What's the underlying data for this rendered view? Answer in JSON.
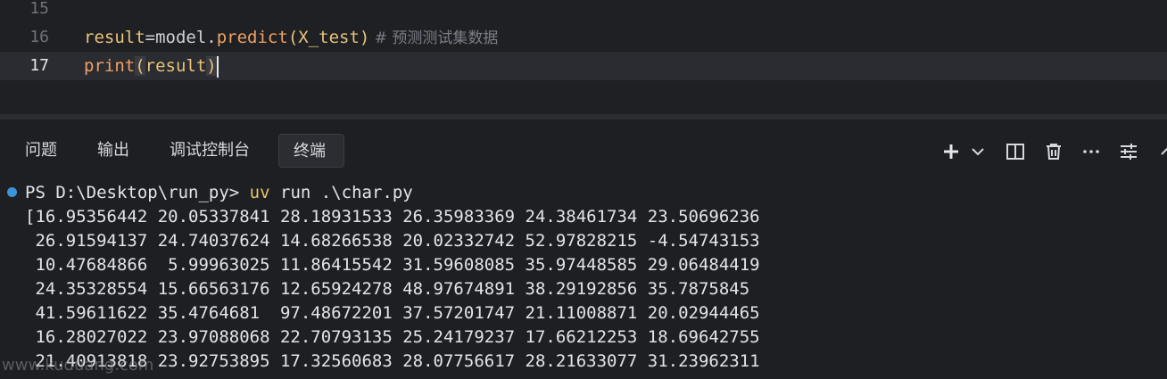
{
  "editor": {
    "lines": [
      {
        "number": "15"
      },
      {
        "number": "16",
        "var": "result",
        "op": "=",
        "obj": "model.",
        "fn": "predict",
        "open": "(",
        "arg": "X_test",
        "close": ")",
        "comment": " # 预测测试集数据"
      },
      {
        "number": "17",
        "fn": "print",
        "open": "(",
        "arg": "result",
        "close": ")"
      }
    ]
  },
  "panel": {
    "tabs": [
      {
        "label": "问题"
      },
      {
        "label": "输出"
      },
      {
        "label": "调试控制台"
      },
      {
        "label": "终端"
      }
    ],
    "active_tab": "终端",
    "actions": [
      "plus-icon",
      "chevron-down-icon",
      "split-icon",
      "trash-icon",
      "more-icon",
      "settings-sliders-icon",
      "chevron-up-icon"
    ]
  },
  "terminal": {
    "prompt": "PS D:\\Desktop\\run_py> ",
    "cmd_uv": "uv",
    "cmd_rest": " run .\\char.py",
    "output": [
      "[16.95356442 20.05337841 28.18931533 26.35983369 24.38461734 23.50696236",
      " 26.91594137 24.74037624 14.68266538 20.02332742 52.97828215 -4.54743153",
      " 10.47684866  5.99963025 11.86415542 31.59608085 35.97448585 29.06484419",
      " 24.35328554 15.66563176 12.65924278 48.97674891 38.29192856 35.7875845",
      " 41.59611622 35.4764681  97.48672201 37.57201747 21.11008871 20.02944465",
      " 16.28027022 23.97088068 22.70793135 25.24179237 17.66212253 18.69642755",
      " 21.40913818 23.92753895 17.32560683 28.07756617 28.21633077 31.23962311"
    ]
  },
  "watermark": "www.kuduang.com"
}
